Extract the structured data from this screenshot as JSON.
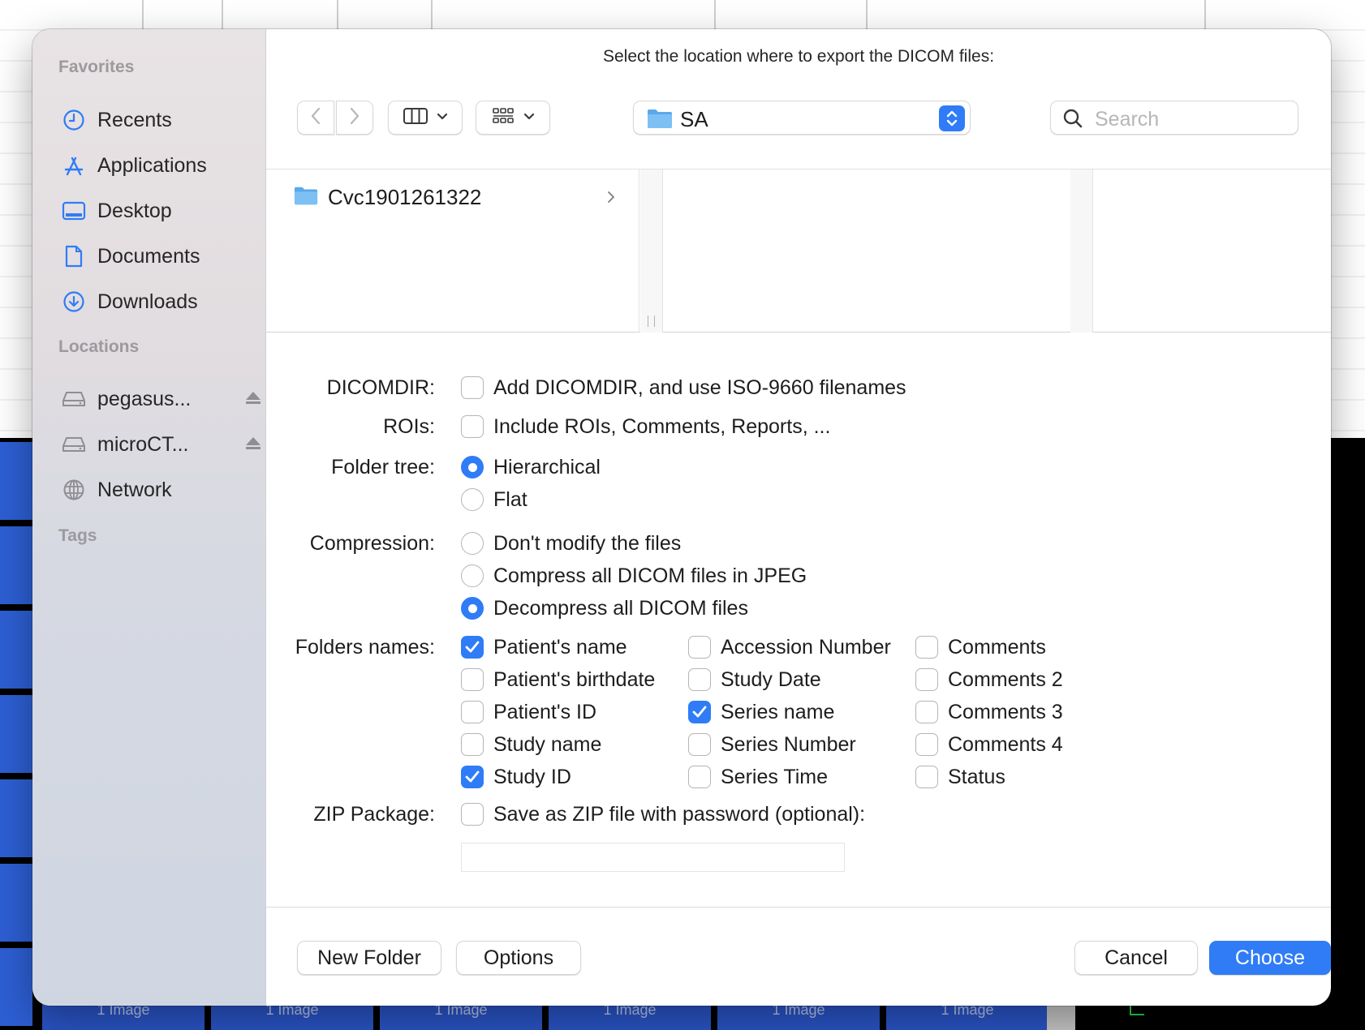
{
  "background": {
    "tile_labels": [
      "1 Image",
      "1 Image",
      "1 Image",
      "1 Image",
      "1 Image",
      "1 Image"
    ]
  },
  "dialog": {
    "title": "Select the location where to export the DICOM files:"
  },
  "sidebar": {
    "favorites_header": "Favorites",
    "favorites": [
      {
        "label": "Recents",
        "icon": "clock-icon"
      },
      {
        "label": "Applications",
        "icon": "applications-icon"
      },
      {
        "label": "Desktop",
        "icon": "desktop-icon"
      },
      {
        "label": "Documents",
        "icon": "document-icon"
      },
      {
        "label": "Downloads",
        "icon": "download-icon"
      }
    ],
    "locations_header": "Locations",
    "locations": [
      {
        "label": "pegasus...",
        "icon": "drive-icon",
        "eject": true
      },
      {
        "label": "microCT...",
        "icon": "drive-icon",
        "eject": true
      },
      {
        "label": "Network",
        "icon": "globe-icon",
        "eject": false
      }
    ],
    "tags_header": "Tags"
  },
  "toolbar": {
    "path_label": "SA",
    "search_placeholder": "Search"
  },
  "browser": {
    "items": [
      {
        "label": "Cvc1901261322",
        "type": "folder"
      }
    ]
  },
  "options": {
    "dicomdir_label": "DICOMDIR:",
    "dicomdir_checkbox": {
      "label": "Add DICOMDIR, and use ISO-9660 filenames",
      "checked": false
    },
    "rois_label": "ROIs:",
    "rois_checkbox": {
      "label": "Include ROIs, Comments, Reports, ...",
      "checked": false
    },
    "folder_tree_label": "Folder tree:",
    "folder_tree": [
      {
        "label": "Hierarchical",
        "selected": true
      },
      {
        "label": "Flat",
        "selected": false
      }
    ],
    "compression_label": "Compression:",
    "compression": [
      {
        "label": "Don't modify the files",
        "selected": false
      },
      {
        "label": "Compress all DICOM files in JPEG",
        "selected": false
      },
      {
        "label": "Decompress all DICOM files",
        "selected": true
      }
    ],
    "folders_names_label": "Folders names:",
    "folders_names": [
      [
        {
          "label": "Patient's name",
          "checked": true
        },
        {
          "label": "Patient's birthdate",
          "checked": false
        },
        {
          "label": "Patient's ID",
          "checked": false
        },
        {
          "label": "Study name",
          "checked": false
        },
        {
          "label": "Study ID",
          "checked": true
        }
      ],
      [
        {
          "label": "Accession Number",
          "checked": false
        },
        {
          "label": "Study Date",
          "checked": false
        },
        {
          "label": "Series name",
          "checked": true
        },
        {
          "label": "Series Number",
          "checked": false
        },
        {
          "label": "Series Time",
          "checked": false
        }
      ],
      [
        {
          "label": "Comments",
          "checked": false
        },
        {
          "label": "Comments 2",
          "checked": false
        },
        {
          "label": "Comments 3",
          "checked": false
        },
        {
          "label": "Comments 4",
          "checked": false
        },
        {
          "label": "Status",
          "checked": false
        }
      ]
    ],
    "zip_label": "ZIP Package:",
    "zip_checkbox": {
      "label": "Save as ZIP file with password (optional):",
      "checked": false
    },
    "zip_password": ""
  },
  "buttons": {
    "new_folder": "New Folder",
    "options": "Options",
    "cancel": "Cancel",
    "choose": "Choose"
  },
  "colors": {
    "accent": "#2f7cf6",
    "sidebar_icon": "#2f7cf6"
  }
}
